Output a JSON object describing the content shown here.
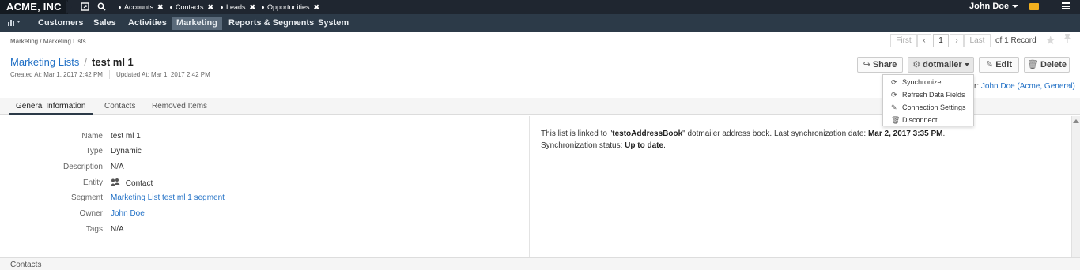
{
  "topbar": {
    "brand": "ACME, INC",
    "pins": [
      {
        "label": "Accounts"
      },
      {
        "label": "Contacts"
      },
      {
        "label": "Leads"
      },
      {
        "label": "Opportunities"
      }
    ],
    "pin_close": "✖",
    "user": "John Doe"
  },
  "nav": {
    "items": [
      "Customers",
      "Sales",
      "Activities",
      "Marketing",
      "Reports & Segments",
      "System"
    ],
    "active": "Marketing"
  },
  "breadcrumb": "Marketing / Marketing Lists",
  "pager": {
    "first": "First",
    "prev": "‹",
    "page": "1",
    "next": "›",
    "last": "Last",
    "total": "of 1 Record"
  },
  "title": {
    "parent": "Marketing Lists",
    "separator": "/",
    "name": "test ml 1",
    "created": "Created At: Mar 1, 2017 2:42 PM",
    "updated": "Updated At: Mar 1, 2017 2:42 PM"
  },
  "actions": {
    "share": "Share",
    "dotmailer": "dotmailer",
    "edit": "Edit",
    "delete": "Delete"
  },
  "owner": {
    "prefix": "r:",
    "name": "John Doe (Acme, General)"
  },
  "dropdown": {
    "items": [
      {
        "label": "Synchronize",
        "icon": "refresh-icon"
      },
      {
        "label": "Refresh Data Fields",
        "icon": "refresh-icon"
      },
      {
        "label": "Connection Settings",
        "icon": "edit-icon"
      },
      {
        "label": "Disconnect",
        "icon": "trash-icon"
      }
    ]
  },
  "tabs": [
    "General Information",
    "Contacts",
    "Removed Items"
  ],
  "fields": [
    {
      "label": "Name",
      "value": "test ml 1"
    },
    {
      "label": "Type",
      "value": "Dynamic"
    },
    {
      "label": "Description",
      "value": "N/A"
    },
    {
      "label": "Entity",
      "value": "Contact"
    },
    {
      "label": "Segment",
      "value": "Marketing List test ml 1 segment"
    },
    {
      "label": "Owner",
      "value": "John Doe"
    },
    {
      "label": "Tags",
      "value": "N/A"
    }
  ],
  "info": {
    "part1": "This list is linked to \"",
    "book": "testoAddressBook",
    "part2": "\" dotmailer address book. Last synchronization date: ",
    "date": "Mar 2, 2017 3:35 PM",
    "part3": ". Synchronization status: ",
    "status": "Up to date",
    "part4": "."
  },
  "bottom_section": "Contacts",
  "colors": {
    "topbar": "#1f2630",
    "navbar": "#2c3a48",
    "link": "#1f6fc5",
    "mail": "#f2b01e"
  }
}
